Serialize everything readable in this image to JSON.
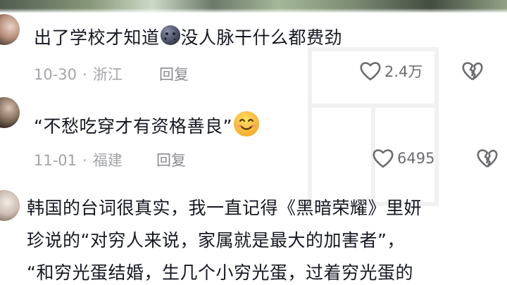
{
  "comments": [
    {
      "text_before": "出了学校才知道",
      "text_after": "没人脉干什么都费劲",
      "emoji": "new-moon-face-emoji",
      "date": "10-30",
      "separator": "·",
      "location": "浙江",
      "reply_label": "回复",
      "likes": "2.4万"
    },
    {
      "text_before": "“不愁吃穿才有资格善良”",
      "text_after": "",
      "emoji": "smiling-face-emoji",
      "date": "11-01",
      "separator": "·",
      "location": "福建",
      "reply_label": "回复",
      "likes": "6495"
    },
    {
      "lines": [
        "韩国的台词很真实，我一直记得《黑暗荣耀》里妍",
        "珍说的“对穷人来说，家属就是最大的加害者”，",
        "“和穷光蛋结婚，生几个小穷光蛋，过着穷光蛋的"
      ]
    }
  ],
  "icons": {
    "like": "heart-outline-icon",
    "dislike": "broken-heart-icon"
  },
  "colors": {
    "text": "#161823",
    "meta": "#a3a4a8",
    "background": "#ffffff"
  }
}
